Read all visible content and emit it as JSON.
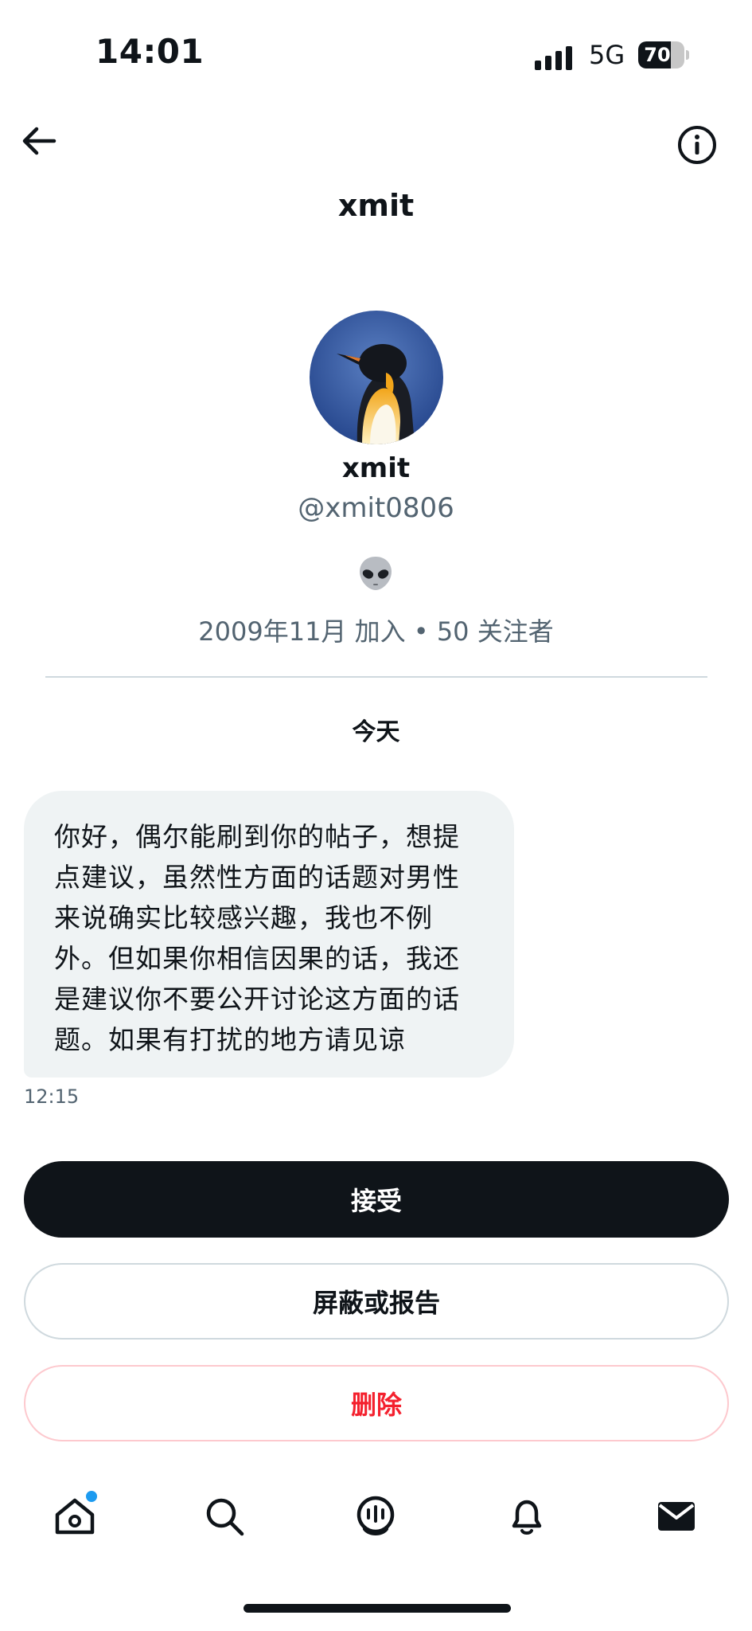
{
  "status_bar": {
    "time": "14:01",
    "network": "5G",
    "battery_percent": "70",
    "battery_level": 0.7
  },
  "header": {
    "title": "xmit",
    "back_icon": "arrow-left-icon",
    "info_icon": "info-icon"
  },
  "profile": {
    "name": "xmit",
    "handle": "@xmit0806",
    "emoji": "alien-icon",
    "meta": "2009年11月 加入 • 50 关注者"
  },
  "conversation": {
    "day_label": "今天",
    "messages": [
      {
        "lines": [
          "你好，偶尔能刷到你的帖子，想提",
          "点建议，虽然性方面的话题对男性",
          "来说确实比较感兴趣，我也不例",
          "外。但如果你相信因果的话，我还",
          "是建议你不要公开讨论这方面的话",
          "题。如果有打扰的地方请见谅"
        ],
        "time": "12:15"
      }
    ]
  },
  "actions": {
    "accept": "接受",
    "block_report": "屏蔽或报告",
    "delete": "删除"
  },
  "bottom_nav": [
    "home-icon",
    "search-icon",
    "spaces-icon",
    "notifications-icon",
    "messages-icon"
  ],
  "colors": {
    "accent": "#1d9bf0",
    "danger": "#f4212e",
    "dark": "#0f1419"
  }
}
